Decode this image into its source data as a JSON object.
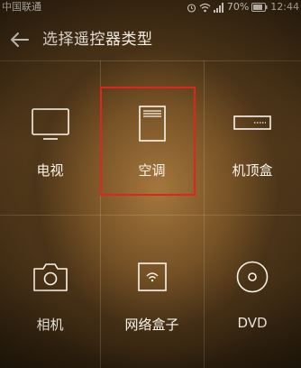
{
  "status_bar": {
    "carrier": "中国联通",
    "battery": "70%",
    "time": "12:44"
  },
  "header": {
    "title": "选择遥控器类型"
  },
  "device_types": [
    {
      "label": "电视",
      "icon": "tv-icon"
    },
    {
      "label": "空调",
      "icon": "air-conditioner-icon",
      "selected": true
    },
    {
      "label": "机顶盒",
      "icon": "set-top-box-icon"
    },
    {
      "label": "相机",
      "icon": "camera-icon"
    },
    {
      "label": "网络盒子",
      "icon": "network-box-icon"
    },
    {
      "label": "DVD",
      "icon": "dvd-icon"
    }
  ],
  "colors": {
    "highlight": "#e0241f",
    "text": "#fbf5ec"
  }
}
